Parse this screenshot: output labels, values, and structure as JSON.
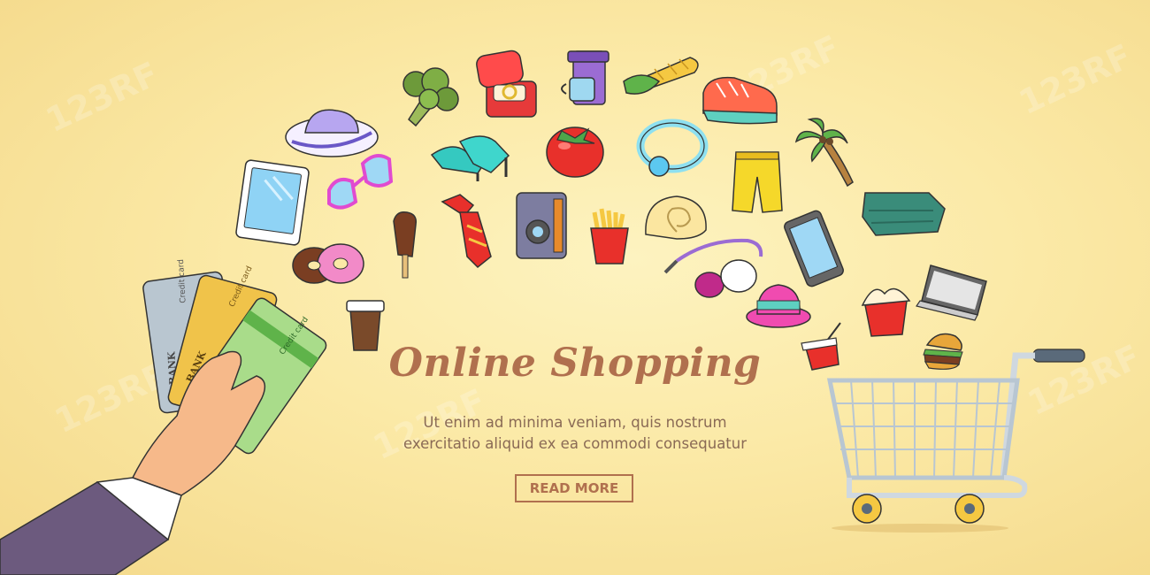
{
  "banner": {
    "headline": "Online Shopping",
    "body_line_1": "Ut enim ad minima veniam, quis nostrum",
    "body_line_2": "exercitatio aliquid ex ea commodi consequatur",
    "read_more_label": "READ MORE"
  },
  "card": {
    "credit_label": "Credit card",
    "bank_label": "BANK"
  },
  "watermark": {
    "text": "123RF"
  },
  "colors": {
    "background": "#fbe9a6",
    "headline": "#b0704e",
    "body_text": "#8a6a55",
    "button_border": "#b0704e"
  },
  "icons": [
    "broccoli-icon",
    "ring-box-icon",
    "coffee-maker-icon",
    "corn-icon",
    "sneaker-icon",
    "sun-hat-icon",
    "high-heels-icon",
    "tomato-icon",
    "bracelet-icon",
    "palm-tree-icon",
    "tablet-icon",
    "sunglasses-icon",
    "popsicle-icon",
    "necktie-icon",
    "camera-icon",
    "french-fries-icon",
    "seashell-icon",
    "shorts-icon",
    "jacket-icon",
    "donut-icon",
    "vacuum-cleaner-icon",
    "smartphone-icon",
    "coffee-cup-icon",
    "fedora-hat-icon",
    "takeout-box-icon",
    "laptop-icon",
    "soda-cup-icon",
    "burger-icon",
    "shopping-cart-icon",
    "hand-with-cards-icon"
  ]
}
